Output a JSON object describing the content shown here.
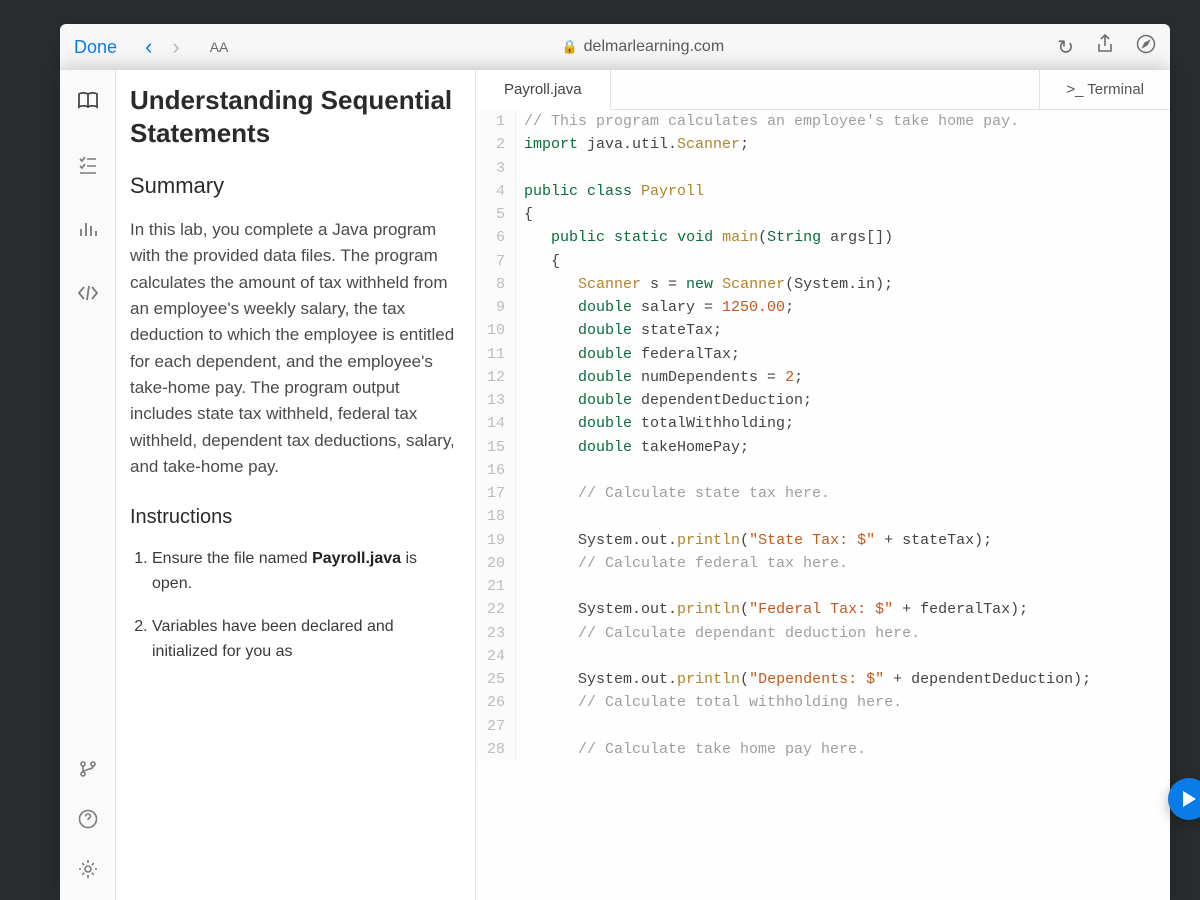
{
  "browser": {
    "done": "Done",
    "aa": "AA",
    "domain": "delmarlearning.com"
  },
  "rail": {
    "items": [
      "book-icon",
      "checklist-icon",
      "bars-icon",
      "code-icon"
    ],
    "bottom": [
      "branch-icon",
      "help-icon",
      "gear-icon"
    ]
  },
  "lesson": {
    "title": "Understanding Sequential Statements",
    "summary_h": "Summary",
    "summary_p": "In this lab, you complete a Java program with the provided data files. The program calculates the amount of tax withheld from an employee's weekly salary, the tax deduction to which the employee is entitled for each dependent, and the employee's take-home pay. The program output includes state tax withheld, federal tax withheld, dependent tax deductions, salary, and take-home pay.",
    "instr_h": "Instructions",
    "instr_1_a": "Ensure the file named ",
    "instr_1_b": "Payroll.java",
    "instr_1_c": " is open.",
    "instr_2": "Variables have been declared and initialized for you as"
  },
  "editor": {
    "tab": "Payroll.java",
    "terminal": ">_ Terminal"
  },
  "code": [
    {
      "n": 1,
      "t": "comment",
      "s": "// This program calculates an employee's take home pay."
    },
    {
      "n": 2,
      "t": "import",
      "s": "import java.util.Scanner;"
    },
    {
      "n": 3,
      "t": "plain",
      "s": ""
    },
    {
      "n": 4,
      "t": "classdecl",
      "s": "public class Payroll"
    },
    {
      "n": 5,
      "t": "plain",
      "s": "{"
    },
    {
      "n": 6,
      "t": "main",
      "s": "   public static void main(String args[])"
    },
    {
      "n": 7,
      "t": "plain",
      "s": "   {"
    },
    {
      "n": 8,
      "t": "scanner",
      "s": "      Scanner s = new Scanner(System.in);"
    },
    {
      "n": 9,
      "t": "decl_num",
      "s": "      double salary = 1250.00;"
    },
    {
      "n": 10,
      "t": "decl",
      "s": "      double stateTax;"
    },
    {
      "n": 11,
      "t": "decl",
      "s": "      double federalTax;"
    },
    {
      "n": 12,
      "t": "decl_num2",
      "s": "      double numDependents = 2;"
    },
    {
      "n": 13,
      "t": "decl",
      "s": "      double dependentDeduction;"
    },
    {
      "n": 14,
      "t": "decl",
      "s": "      double totalWithholding;"
    },
    {
      "n": 15,
      "t": "decl",
      "s": "      double takeHomePay;"
    },
    {
      "n": 16,
      "t": "plain",
      "s": ""
    },
    {
      "n": 17,
      "t": "comment",
      "s": "      // Calculate state tax here."
    },
    {
      "n": 18,
      "t": "plain",
      "s": ""
    },
    {
      "n": 19,
      "t": "print",
      "s": "      System.out.println(\"State Tax: $\" + stateTax);"
    },
    {
      "n": 20,
      "t": "comment",
      "s": "      // Calculate federal tax here."
    },
    {
      "n": 21,
      "t": "plain",
      "s": ""
    },
    {
      "n": 22,
      "t": "print",
      "s": "      System.out.println(\"Federal Tax: $\" + federalTax);"
    },
    {
      "n": 23,
      "t": "comment",
      "s": "      // Calculate dependant deduction here."
    },
    {
      "n": 24,
      "t": "plain",
      "s": ""
    },
    {
      "n": 25,
      "t": "print",
      "s": "      System.out.println(\"Dependents: $\" + dependentDeduction);"
    },
    {
      "n": 26,
      "t": "comment",
      "s": "      // Calculate total withholding here."
    },
    {
      "n": 27,
      "t": "plain",
      "s": ""
    },
    {
      "n": 28,
      "t": "comment",
      "s": "      // Calculate take home pay here."
    }
  ]
}
